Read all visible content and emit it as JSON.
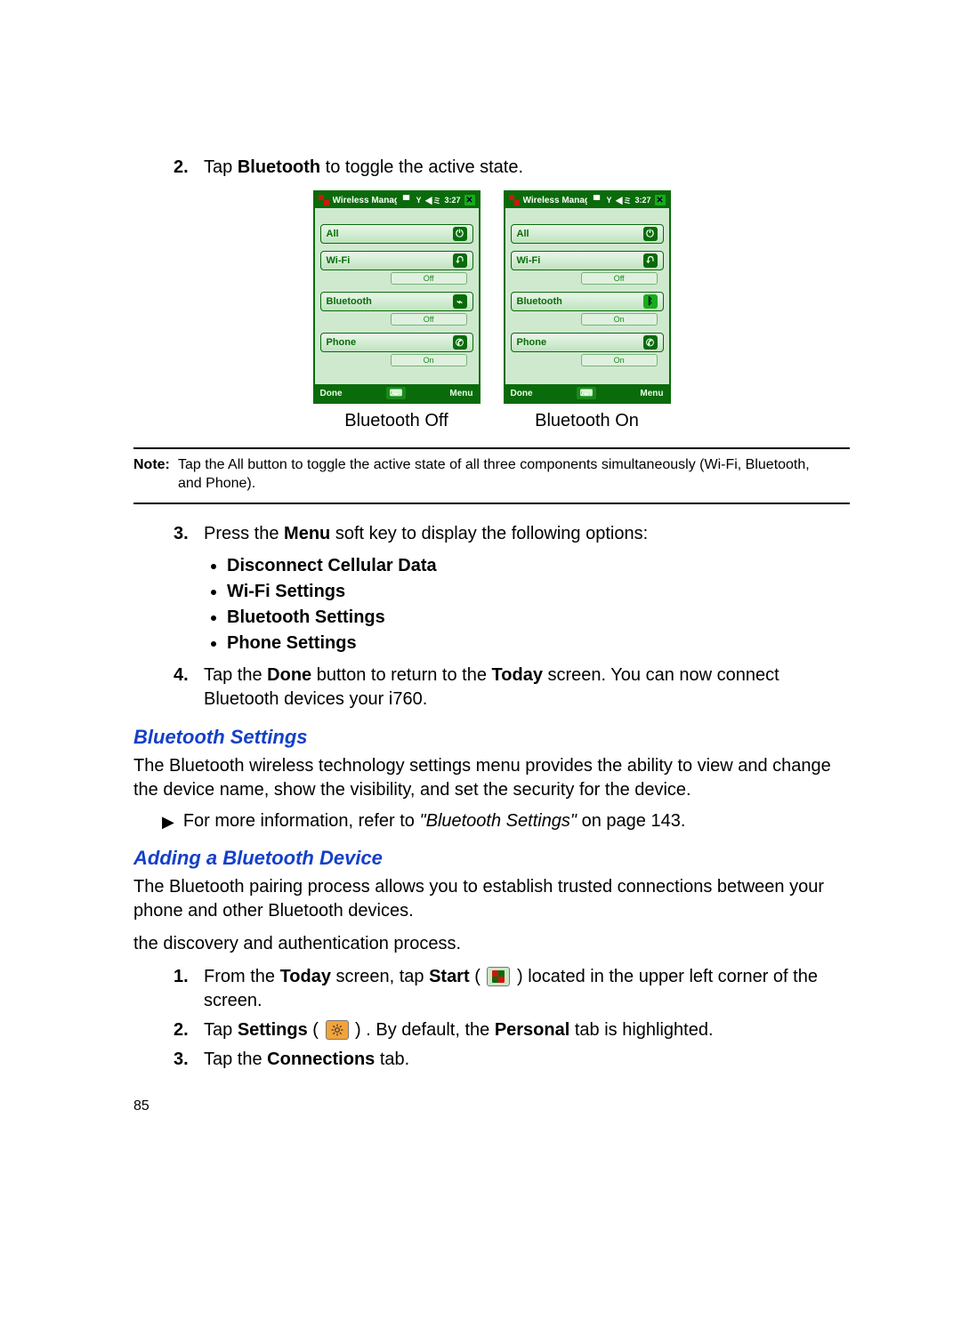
{
  "step2": {
    "num": "2.",
    "pre": "Tap ",
    "bold": "Bluetooth",
    "post": " to toggle the active state."
  },
  "screens": {
    "titlebar_title": "Wireless Manag",
    "titlebar_time": "3:27",
    "rows": {
      "all": "All",
      "wifi": "Wi-Fi",
      "bt": "Bluetooth",
      "phone": "Phone"
    },
    "status": {
      "off": "Off",
      "on": "On"
    },
    "bottom": {
      "done": "Done",
      "menu": "Menu"
    },
    "left_caption": "Bluetooth Off",
    "right_caption": "Bluetooth On"
  },
  "note": {
    "label": "Note:",
    "line1": "Tap the All button to toggle the active state of all three components simultaneously (Wi-Fi, Bluetooth,",
    "line2": "and Phone)."
  },
  "step3": {
    "num": "3.",
    "pre": "Press the ",
    "bold": "Menu",
    "post": " soft key to display the following options:"
  },
  "menu_options": [
    "Disconnect Cellular Data",
    "Wi-Fi Settings",
    "Bluetooth Settings",
    "Phone Settings"
  ],
  "step4": {
    "num": "4.",
    "pre": "Tap the ",
    "bold1": "Done",
    "mid1": " button to return to the ",
    "bold2": "Today",
    "mid2": " screen. You can now connect Bluetooth devices your i760."
  },
  "bt_settings": {
    "heading": "Bluetooth Settings",
    "para": "The Bluetooth wireless technology settings menu provides the ability to view and change the device name, show the visibility, and set the security for the device.",
    "arrow_pre": "For more information, refer to ",
    "arrow_ref": "\"Bluetooth Settings\"",
    "arrow_post": "  on page 143."
  },
  "adding": {
    "heading": "Adding a Bluetooth Device",
    "para1": "The Bluetooth pairing process allows you to establish trusted connections between your phone and other Bluetooth devices.",
    "para2": "the discovery and authentication process.",
    "s1": {
      "num": "1.",
      "pre": "From the ",
      "b1": "Today",
      "mid": " screen, tap ",
      "b2": "Start",
      "post": " located in the upper left corner of the screen."
    },
    "s2": {
      "num": "2.",
      "pre": "Tap ",
      "b1": "Settings",
      "mid": ". By default, the ",
      "b2": "Personal",
      "post": " tab is highlighted."
    },
    "s3": {
      "num": "3.",
      "pre": "Tap the ",
      "b1": "Connections",
      "post": " tab."
    }
  },
  "page_number": "85"
}
